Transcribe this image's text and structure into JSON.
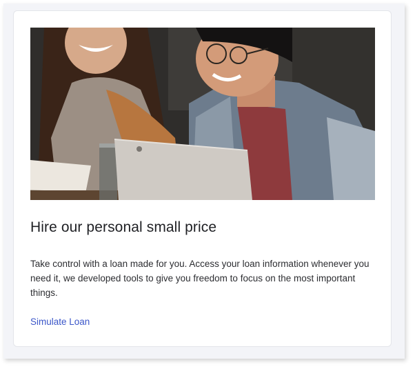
{
  "card": {
    "image_alt": "Two people laughing in front of a laptop",
    "title": "Hire our personal small price",
    "description": "Take control with a loan made for you. Access your loan information whenever you need it, we developed tools to give you freedom to focus on the most important things.",
    "link_label": "Simulate Loan"
  },
  "colors": {
    "frame_bg": "#f3f4f8",
    "card_bg": "#ffffff",
    "title": "#1f2024",
    "body_text": "#2c2d31",
    "link": "#3b56c9"
  }
}
